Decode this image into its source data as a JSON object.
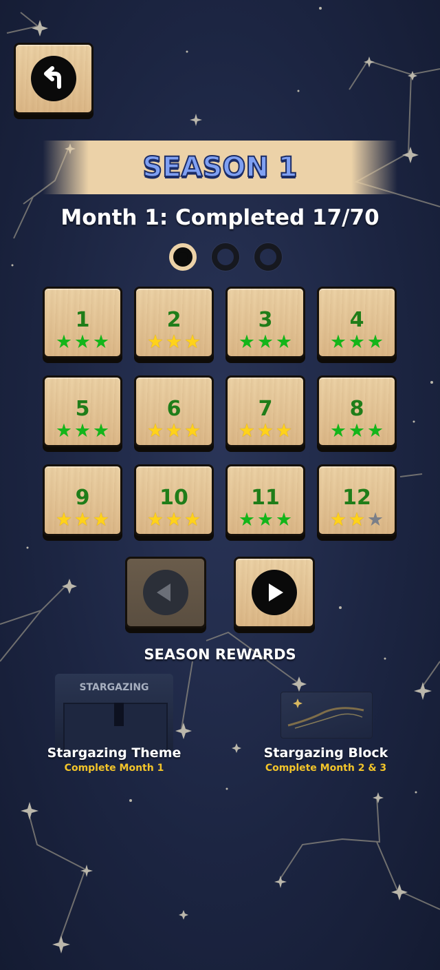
{
  "season": {
    "title": "SEASON 1"
  },
  "month": {
    "label": "Month 1: Completed 17/70"
  },
  "pages": {
    "count": 3,
    "active_index": 0
  },
  "levels": [
    {
      "number": "1",
      "stars": [
        "green",
        "green",
        "green"
      ]
    },
    {
      "number": "2",
      "stars": [
        "gold",
        "gold",
        "gold"
      ]
    },
    {
      "number": "3",
      "stars": [
        "green",
        "green",
        "green"
      ]
    },
    {
      "number": "4",
      "stars": [
        "green",
        "green",
        "green"
      ]
    },
    {
      "number": "5",
      "stars": [
        "green",
        "green",
        "green"
      ]
    },
    {
      "number": "6",
      "stars": [
        "gold",
        "gold",
        "gold"
      ]
    },
    {
      "number": "7",
      "stars": [
        "gold",
        "gold",
        "gold"
      ]
    },
    {
      "number": "8",
      "stars": [
        "green",
        "green",
        "green"
      ]
    },
    {
      "number": "9",
      "stars": [
        "gold",
        "gold",
        "gold"
      ]
    },
    {
      "number": "10",
      "stars": [
        "gold",
        "gold",
        "gold"
      ]
    },
    {
      "number": "11",
      "stars": [
        "green",
        "green",
        "green"
      ]
    },
    {
      "number": "12",
      "stars": [
        "gold",
        "gold",
        "grey"
      ]
    }
  ],
  "navigation": {
    "back_icon": "back-arrow-icon",
    "prev_icon": "triangle-left-icon",
    "prev_enabled": false,
    "next_icon": "triangle-right-icon",
    "next_enabled": true
  },
  "rewards": {
    "title": "SEASON REWARDS",
    "items": [
      {
        "name": "Stargazing Theme",
        "requirement": "Complete Month 1",
        "thumb_title": "STARGAZING"
      },
      {
        "name": "Stargazing Block",
        "requirement": "Complete Month 2 & 3"
      }
    ]
  },
  "colors": {
    "wood": "#e6c799",
    "level_number": "#1f7d19",
    "star_green": "#14b51a",
    "star_gold": "#ffd21a",
    "star_grey": "#7b7f88",
    "reward_requirement": "#f3c52a",
    "season_title": "#7fa0f2",
    "background": "#1c2542"
  }
}
